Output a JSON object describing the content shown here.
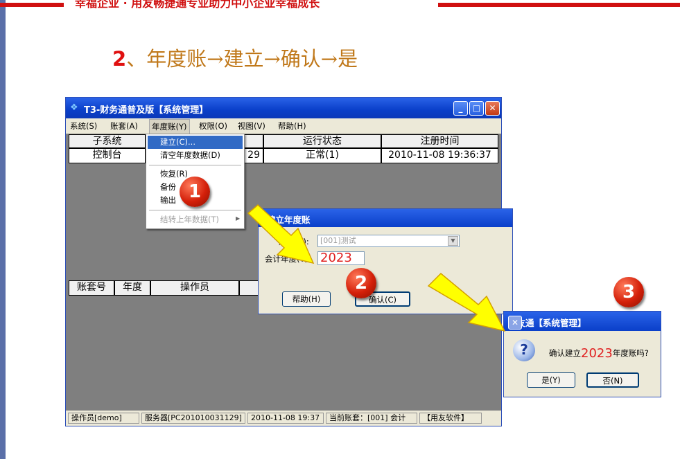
{
  "slide": {
    "banner": "幸福企业 · 用友畅捷通专业助力中小企业幸福成长",
    "heading_num": "2",
    "heading_rest": "、年度账→建立→确认→是"
  },
  "main_window": {
    "title": "T3-财务通普及版【系统管理】",
    "menu": [
      "系统(S)",
      "账套(A)",
      "年度账(Y)",
      "权限(O)",
      "视图(V)",
      "帮助(H)"
    ],
    "top_table": {
      "headers": [
        "子系统",
        "",
        "运行状态",
        "注册时间"
      ],
      "row": [
        "控制台",
        "29",
        "正常(1)",
        "2010-11-08 19:36:37"
      ]
    },
    "bottom_table": {
      "headers": [
        "账套号",
        "年度",
        "操作员"
      ]
    },
    "status_bar": [
      "操作员[demo]",
      "服务器[PC201010031129]",
      "2010-11-08 19:37",
      "当前账套：[001] 会计",
      "【用友软件】"
    ]
  },
  "dropdown": {
    "items": [
      "建立(C)...",
      "清空年度数据(D)",
      "恢复(R)",
      "备份",
      "输出",
      "结转上年数据(T)"
    ]
  },
  "dialog_create": {
    "title": "建立年度账",
    "account_label": "账套(A):",
    "account_value": "[001]测试",
    "year_label": "会计年度(Y):",
    "year_value": "2023",
    "help_button": "帮助(H)",
    "ok_button": "确认(C)"
  },
  "dialog_confirm": {
    "title": "用友通【系统管理】",
    "message_pre": "确认建立",
    "message_year": "2023",
    "message_post": "年度账吗?",
    "yes_button": "是(Y)",
    "no_button": "否(N)"
  },
  "steps": [
    "1",
    "2",
    "3"
  ],
  "colors": {
    "title_blue": "#0a3fc9",
    "step_red": "#d4200a",
    "arrow_yellow": "#ffff00",
    "heading_gold": "#c0781a"
  }
}
